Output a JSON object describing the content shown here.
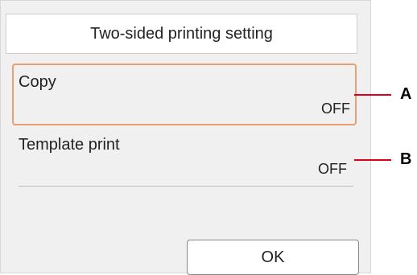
{
  "screen": {
    "title": "Two-sided printing setting"
  },
  "settings": [
    {
      "label": "Copy",
      "value": "OFF"
    },
    {
      "label": "Template print",
      "value": "OFF"
    }
  ],
  "actions": {
    "ok_label": "OK"
  },
  "callouts": {
    "a_label": "A",
    "b_label": "B",
    "color": "#d9001b"
  },
  "colors": {
    "selection_border": "#e8a070",
    "screen_background": "#f0f0f0"
  }
}
